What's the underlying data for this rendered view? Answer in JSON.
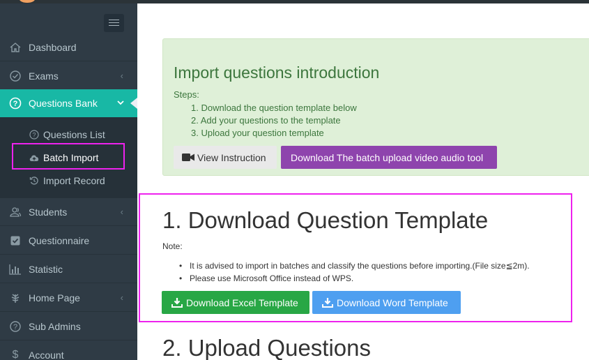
{
  "sidebar": {
    "toggle_icon": "hamburger-icon",
    "items": [
      {
        "label": "Dashboard",
        "icon": "home-icon"
      },
      {
        "label": "Exams",
        "icon": "check-circle-icon",
        "caret": "‹"
      },
      {
        "label": "Questions Bank",
        "icon": "question-circle-icon",
        "caret": "⌄"
      },
      {
        "label": "Students",
        "icon": "users-icon",
        "caret": "‹"
      },
      {
        "label": "Questionnaire",
        "icon": "checkbox-icon"
      },
      {
        "label": "Statistic",
        "icon": "bar-chart-icon"
      },
      {
        "label": "Home Page",
        "icon": "leaf-icon",
        "caret": "‹"
      },
      {
        "label": "Sub Admins",
        "icon": "question-circle-icon"
      },
      {
        "label": "Account",
        "icon": "dollar-icon"
      }
    ],
    "submenu": [
      {
        "label": "Questions List",
        "icon": "question-circle-icon"
      },
      {
        "label": "Batch Import",
        "icon": "cloud-upload-icon"
      },
      {
        "label": "Import Record",
        "icon": "history-icon"
      }
    ]
  },
  "intro": {
    "title": "Import questions introduction",
    "steps_label": "Steps:",
    "steps": [
      "1. Download the question template below",
      "2. Add your questions to the template",
      "3. Upload your question template"
    ],
    "view_instruction": "View Instruction",
    "download_tool": "Download The batch upload video audio tool"
  },
  "download_section": {
    "title": "1. Download Question Template",
    "note_label": "Note:",
    "notes": [
      "It is advised to import in batches and classify the questions before importing.(File size≦2m).",
      "Please use Microsoft Office instead of WPS."
    ],
    "excel_button": "Download Excel Template",
    "word_button": "Download Word Template"
  },
  "upload_section": {
    "title": "2. Upload Questions"
  },
  "colors": {
    "sidebar_bg": "#2f3b45",
    "active_item": "#18b8a5",
    "intro_bg": "#dff0d8",
    "tool_button": "#8e44ad",
    "excel_button": "#28a745",
    "word_button": "#4e9ff0",
    "highlight": "#ee22ee"
  }
}
